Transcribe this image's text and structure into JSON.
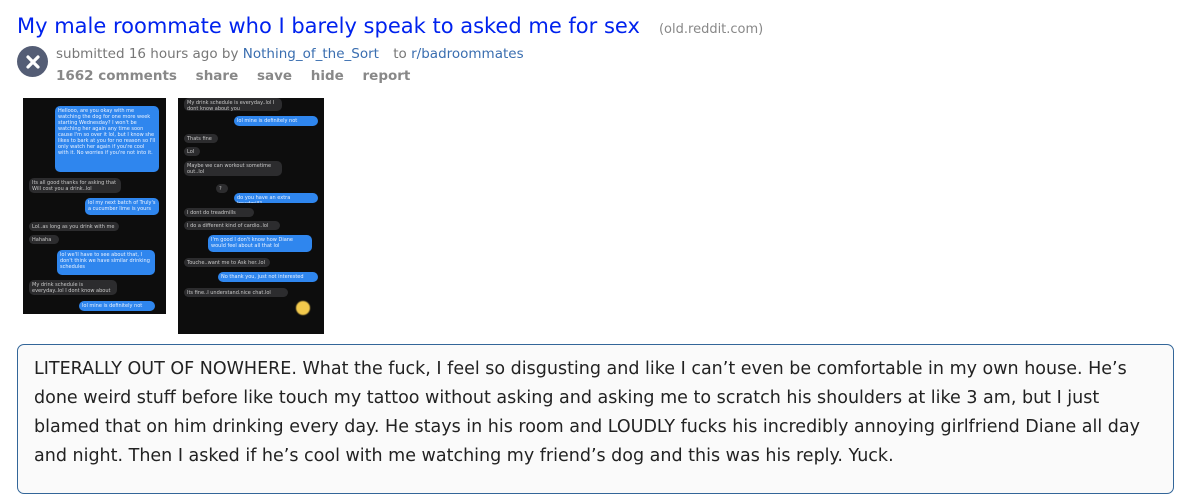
{
  "post": {
    "title": "My male roommate who I barely speak to asked me for sex",
    "domain": "(old.reddit.com)",
    "submitted_prefix": "submitted 16 hours ago by",
    "author": "Nothing_of_the_Sort",
    "to_label": "to",
    "subreddit": "r/badroommates",
    "comments": "1662 comments",
    "share": "share",
    "save": "save",
    "hide": "hide",
    "report": "report",
    "body": "LITERALLY OUT OF NOWHERE. What the fuck, I feel so disgusting and like I can’t even be comfortable in my own house. He’s done weird stuff before like touch my tattoo without asking and asking me to scratch his shoulders at like 3 am, but I just blamed that on him drinking every day. He stays in his room and LOUDLY fucks his incredibly annoying girlfriend Diane all day and night. Then I asked if he’s cool with me watching my friend’s dog and this was his reply. Yuck."
  },
  "screenshot_left": {
    "messages": [
      {
        "dir": "out",
        "text": "Hellooo, are you okay with me watching the dog for one more week starting Wednesday? I won't be watching her again any time soon cause I'm so over it lol, but I know she likes to bark at you for no reason so I'll only watch her again if you're cool with it. No worries if you're not into it."
      },
      {
        "dir": "in",
        "text": "Its all good thanks for asking that Will cost you a drink..lol"
      },
      {
        "dir": "out",
        "text": "lol my next batch of Truly's a cucumber lime is yours"
      },
      {
        "dir": "in",
        "text": "Lol..as long as you drink with me"
      },
      {
        "dir": "in",
        "text": "Hahaha"
      },
      {
        "dir": "out",
        "text": "lol we'll have to see about that, I don't think we have similar drinking schedules"
      },
      {
        "dir": "in",
        "text": "My drink schedule is everyday..lol I dont know about you"
      },
      {
        "dir": "out",
        "text": "lol mine is definitely not"
      }
    ]
  },
  "screenshot_right": {
    "messages": [
      {
        "dir": "in",
        "text": "My drink schedule is everyday..lol I dont know about you"
      },
      {
        "dir": "out",
        "text": "lol mine is definitely not"
      },
      {
        "dir": "in",
        "text": "Thats fine"
      },
      {
        "dir": "in",
        "text": "Lol"
      },
      {
        "dir": "in",
        "text": "Maybe we can workout sometime out..lol"
      },
      {
        "dir": "in",
        "text": "?"
      },
      {
        "dir": "out",
        "text": "do you have an extra treadmill?"
      },
      {
        "dir": "in",
        "text": "I dont do treadmills"
      },
      {
        "dir": "in",
        "text": "I do a different kind of cardio..lol"
      },
      {
        "dir": "out",
        "text": "I'm good I don't know how Diane would feel about all that lol"
      },
      {
        "dir": "in",
        "text": "Touche..want me to Ask her..lol"
      },
      {
        "dir": "out",
        "text": "No thank you, just not interested"
      },
      {
        "dir": "in",
        "text": "Its fine..I understand.nice chat.lol"
      }
    ]
  },
  "colors": {
    "title": "#0022ee",
    "link": "#3a6eb0",
    "bubble_out": "#2f86ee",
    "bubble_in": "#2c2c2e",
    "selftext_border": "#336699"
  },
  "icons": {
    "close": "close-icon"
  }
}
